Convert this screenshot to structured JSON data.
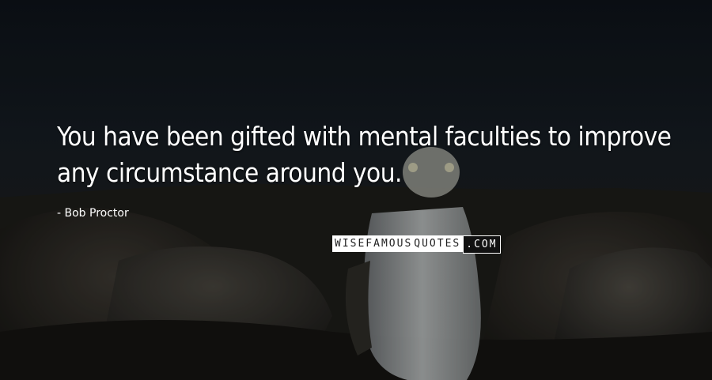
{
  "quote": {
    "line1": "You have been gifted with mental faculties to improve",
    "line2": "any circumstance around you."
  },
  "author": "Bob Proctor",
  "brand": {
    "part1": "WISEFAMOUS",
    "part2": "QUOTES",
    "part3": ".COM"
  }
}
